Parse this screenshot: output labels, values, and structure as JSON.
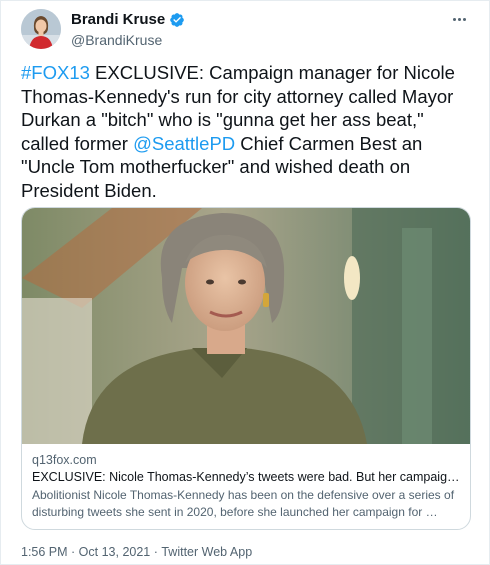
{
  "author": {
    "display_name": "Brandi Kruse",
    "handle": "@BrandiKruse",
    "verified": true
  },
  "tweet": {
    "hashtag": "#FOX13",
    "text_part1": " EXCLUSIVE: Campaign manager for Nicole Thomas-Kennedy's run for city attorney called Mayor Durkan a \"bitch\" who is \"gunna get her ass beat,\" called former ",
    "mention": "@SeattlePD",
    "text_part2": " Chief Carmen Best an \"Uncle Tom motherfucker\" and wished death on President Biden."
  },
  "card": {
    "domain": "q13fox.com",
    "title": "EXCLUSIVE: Nicole Thomas-Kennedy’s tweets were bad. But her campaign ma…",
    "description": "Abolitionist Nicole Thomas-Kennedy has been on the defensive over a series of disturbing tweets she sent in 2020, before she launched her campaign for …"
  },
  "meta": {
    "time": "1:56 PM",
    "separator1": " · ",
    "date": "Oct 13, 2021",
    "separator2": " · ",
    "source": "Twitter Web App"
  },
  "colors": {
    "link": "#1d9bf0",
    "text": "#0f1419",
    "secondary": "#536471",
    "border": "#cfd9de"
  },
  "icons": {
    "verified": "verified-badge-icon",
    "more": "more-options-icon"
  }
}
